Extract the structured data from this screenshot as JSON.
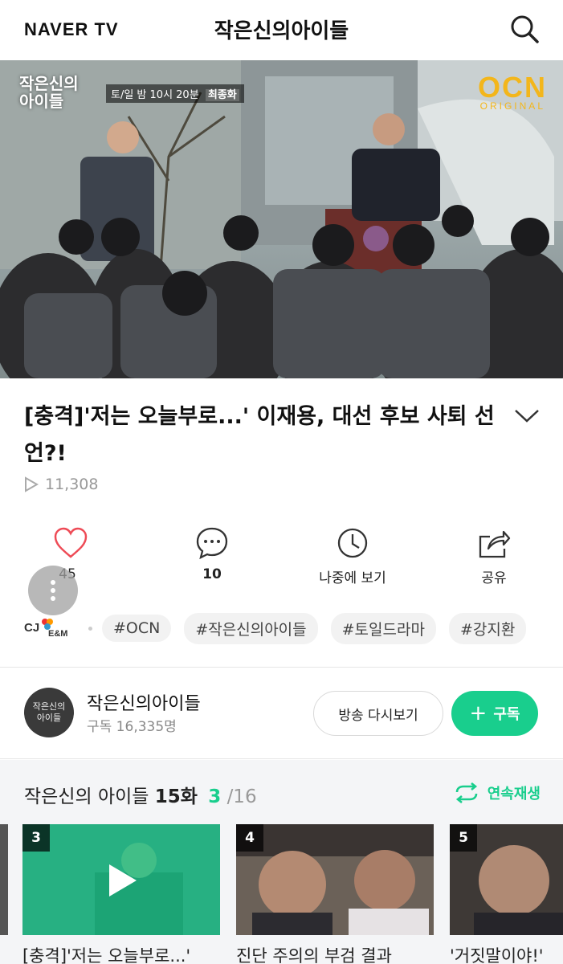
{
  "header": {
    "logo": "NAVER TV",
    "title": "작은신의아이들",
    "search_icon": "search-icon"
  },
  "video": {
    "show_logo_line1": "작은신의",
    "show_logo_line2": "아이들",
    "schedule": "토/일 밤 10시 20분",
    "schedule_highlight": "최종화",
    "channel_brand": "OCN",
    "channel_brand_sub": "ORIGINAL"
  },
  "title": "[충격]'저는 오늘부로...' 이재용, 대선 후보 사퇴 선언?!",
  "views": "11,308",
  "actions": {
    "like_count": "45",
    "comment_count": "10",
    "watch_later": "나중에 보기",
    "share": "공유"
  },
  "publisher": "CJ E&M",
  "tags": [
    "#OCN",
    "#작은신의아이들",
    "#토일드라마",
    "#강지환"
  ],
  "channel": {
    "name": "작은신의아이들",
    "subscribers": "구독 16,335명",
    "avatar_text_1": "작은신의",
    "avatar_text_2": "아이들",
    "replay_button": "방송 다시보기",
    "subscribe_button": "구독"
  },
  "playlist": {
    "title": "작은신의 아이들",
    "episode": "15화",
    "current": "3",
    "total": "/16",
    "autoplay": "연속재생",
    "items": [
      {
        "num": "3",
        "caption": "[충격]'저는 오늘부로...'",
        "active": true
      },
      {
        "num": "4",
        "caption": "진단 주의의 부검 결과",
        "active": false
      },
      {
        "num": "5",
        "caption": "'거짓말이야!'",
        "active": false
      }
    ]
  },
  "colors": {
    "accent": "#19ce8d",
    "like": "#ee4b56",
    "ocn": "#f3b61b"
  }
}
